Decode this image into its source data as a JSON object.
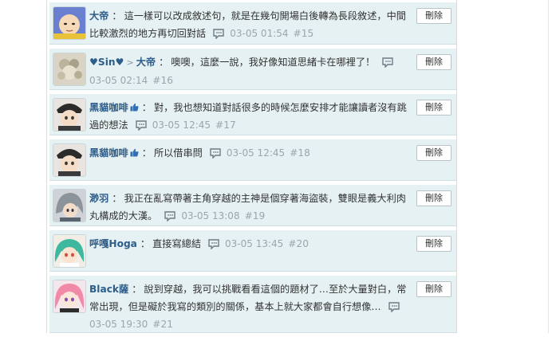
{
  "delete_label": "刪除",
  "comments": [
    {
      "user": "大帝",
      "text": "這一樣可以改成敘述句，就是在幾句開場白後轉為長段敘述，中間比較激烈的地方再切回對話",
      "time": "03-05 01:54",
      "floor": "#15"
    },
    {
      "user": "♥Sin♥",
      "reply_to": "大帝",
      "text": "噢噢，這麼一說，我好像知道思緒卡在哪裡了！",
      "time": "03-05 02:14",
      "floor": "#16"
    },
    {
      "user": "黑貓咖啡",
      "thumb": true,
      "text": "對，我也想知道對話很多的時候怎麼安排才能讓讀者沒有跳過的想法",
      "time": "03-05 12:45",
      "floor": "#17"
    },
    {
      "user": "黑貓咖啡",
      "thumb": true,
      "text": "所以借串問",
      "time": "03-05 12:45",
      "floor": "#18"
    },
    {
      "user": "渺羽",
      "text": "我正在亂寫帶著主角穿越的主神是個穿著海盜裝，雙眼是義大利肉丸構成的大漢。",
      "time": "03-05 13:08",
      "floor": "#19"
    },
    {
      "user": "呼嘎Hoga",
      "text": "直接寫總結",
      "time": "03-05 13:45",
      "floor": "#20"
    },
    {
      "user": "Black薩",
      "text": "說到穿越，我可以挑戰看看這個的題材了…至於大量對白，常常出現，但是礙於我寫的類別的關係，基本上就大家都會自行想像…",
      "time": "03-05 19:30",
      "floor": "#21"
    }
  ]
}
